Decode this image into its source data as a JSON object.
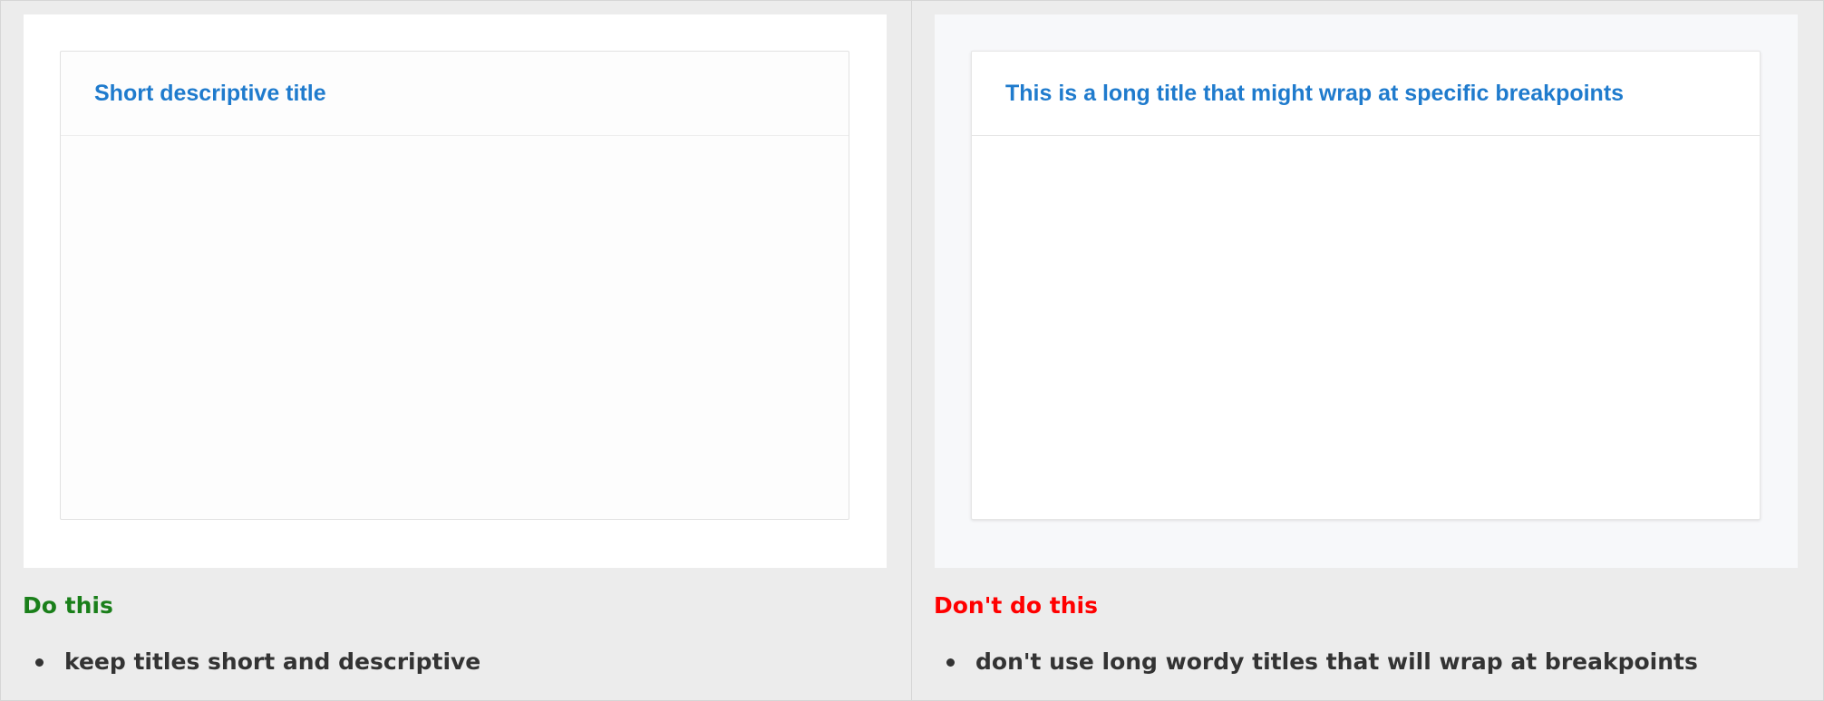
{
  "good": {
    "card_title": "Short descriptive title",
    "caption": "Do this",
    "bullets": [
      "keep titles short and descriptive"
    ],
    "caption_color": "#1a7f1a"
  },
  "bad": {
    "card_title": "This is a long title that might wrap at specific breakpoints",
    "caption": "Don't do this",
    "bullets": [
      "don't use long wordy titles that will wrap at breakpoints"
    ],
    "caption_color": "#ff0000"
  },
  "colors": {
    "title_blue": "#1f7bcd",
    "page_background": "#ececec",
    "body_text": "#333333"
  }
}
